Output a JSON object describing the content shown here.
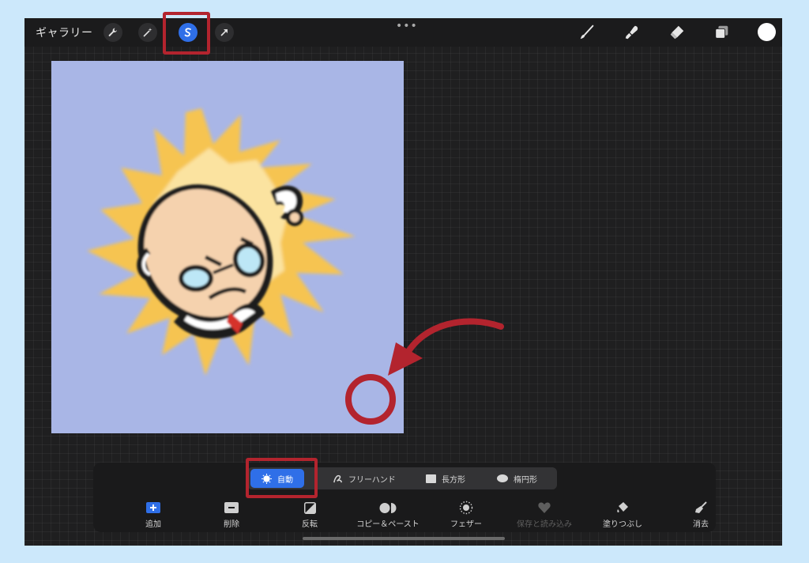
{
  "topbar": {
    "gallery_label": "ギャラリー",
    "more_dots": "•••",
    "tools_left": [
      "wrench-icon",
      "magic-wand-icon",
      "selection-icon",
      "transform-arrow-icon"
    ],
    "tools_right": [
      "brush-icon",
      "smudge-icon",
      "eraser-icon",
      "layers-icon",
      "color-swatch"
    ],
    "active_tool": "selection-icon",
    "current_color": "#ffffff"
  },
  "selection_toolbar": {
    "modes": [
      {
        "label": "自動",
        "icon": "auto-icon",
        "active": true
      },
      {
        "label": "フリーハンド",
        "icon": "freehand-icon",
        "active": false
      },
      {
        "label": "長方形",
        "icon": "rectangle-icon",
        "active": false
      },
      {
        "label": "楕円形",
        "icon": "ellipse-icon",
        "active": false
      }
    ],
    "actions": [
      {
        "label": "追加",
        "icon": "add-icon",
        "enabled": true
      },
      {
        "label": "削除",
        "icon": "remove-icon",
        "enabled": true
      },
      {
        "label": "反転",
        "icon": "invert-icon",
        "enabled": true
      },
      {
        "label": "コピー＆ペースト",
        "icon": "copy-paste-icon",
        "enabled": true
      },
      {
        "label": "フェザー",
        "icon": "feather-icon",
        "enabled": true
      },
      {
        "label": "保存と読み込み",
        "icon": "heart-icon",
        "enabled": false
      },
      {
        "label": "塗りつぶし",
        "icon": "fill-bucket-icon",
        "enabled": true
      },
      {
        "label": "消去",
        "icon": "clear-broom-icon",
        "enabled": true
      }
    ]
  },
  "colors": {
    "accent": "#2f6fe8",
    "annotation": "#b3242e",
    "canvas_bg": "#a9b6e6"
  }
}
